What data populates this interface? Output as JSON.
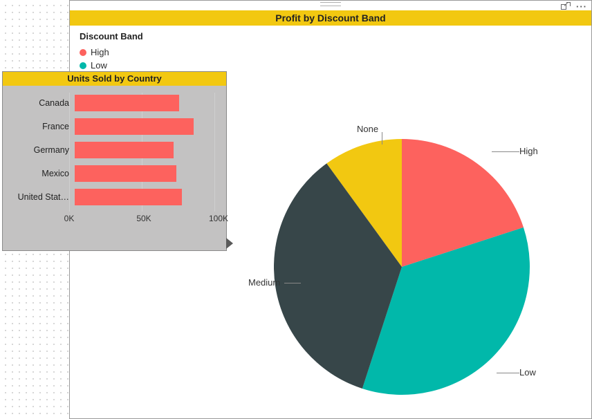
{
  "main": {
    "title": "Profit by Discount Band",
    "legend_title": "Discount Band",
    "legend_items": [
      {
        "label": "High",
        "color": "#fd625e"
      },
      {
        "label": "Low",
        "color": "#01b8aa"
      },
      {
        "label": "Medium",
        "color": "#374649"
      },
      {
        "label": "None",
        "color": "#f2c811"
      }
    ],
    "pie_labels": {
      "high": "High",
      "low": "Low",
      "medium": "Medium",
      "none": "None"
    }
  },
  "tooltip": {
    "title": "Units Sold by Country",
    "axis_ticks": [
      "0K",
      "50K",
      "100K"
    ],
    "rows": [
      {
        "label": "Canada",
        "value": 72000
      },
      {
        "label": "France",
        "value": 82000
      },
      {
        "label": "Germany",
        "value": 68000
      },
      {
        "label": "Mexico",
        "value": 70000
      },
      {
        "label": "United Stat…",
        "value": 74000
      }
    ],
    "xmax": 100000
  },
  "colors": {
    "high": "#fd625e",
    "low": "#01b8aa",
    "medium": "#374649",
    "none": "#f2c811",
    "accent": "#f2c811"
  },
  "chart_data": [
    {
      "type": "pie",
      "title": "Profit by Discount Band",
      "series_name": "Discount Band",
      "slices": [
        {
          "name": "High",
          "value": 20,
          "color": "#fd625e"
        },
        {
          "name": "Low",
          "value": 35,
          "color": "#01b8aa"
        },
        {
          "name": "Medium",
          "value": 35,
          "color": "#374649"
        },
        {
          "name": "None",
          "value": 10,
          "color": "#f2c811"
        }
      ]
    },
    {
      "type": "bar",
      "orientation": "horizontal",
      "title": "Units Sold by Country",
      "xlabel": "",
      "ylabel": "",
      "xlim": [
        0,
        100000
      ],
      "x_ticks": [
        0,
        50000,
        100000
      ],
      "categories": [
        "Canada",
        "France",
        "Germany",
        "Mexico",
        "United States"
      ],
      "values": [
        72000,
        82000,
        68000,
        70000,
        74000
      ],
      "color": "#fd625e"
    }
  ]
}
